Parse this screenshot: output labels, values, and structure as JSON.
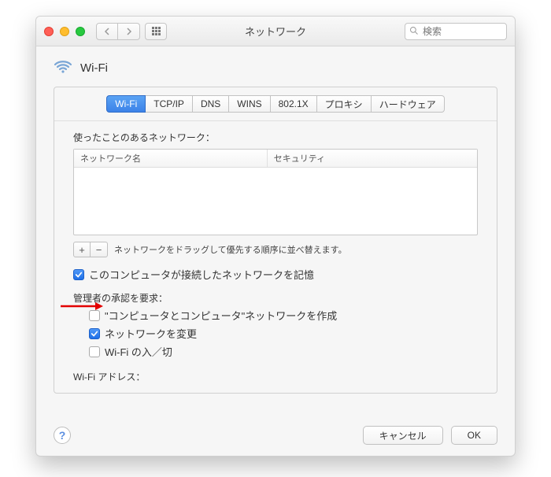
{
  "window": {
    "title": "ネットワーク",
    "search_placeholder": "検索"
  },
  "header": {
    "title": "Wi-Fi"
  },
  "tabs": [
    {
      "label": "Wi-Fi",
      "active": true
    },
    {
      "label": "TCP/IP",
      "active": false
    },
    {
      "label": "DNS",
      "active": false
    },
    {
      "label": "WINS",
      "active": false
    },
    {
      "label": "802.1X",
      "active": false
    },
    {
      "label": "プロキシ",
      "active": false
    },
    {
      "label": "ハードウェア",
      "active": false
    }
  ],
  "network_list": {
    "caption": "使ったことのあるネットワーク：",
    "col_name": "ネットワーク名",
    "col_security": "セキュリティ",
    "rows": []
  },
  "pm": {
    "plus": "+",
    "minus": "−",
    "hint": "ネットワークをドラッグして優先する順序に並べ替えます。"
  },
  "remember": {
    "checked": true,
    "label": "このコンピュータが接続したネットワークを記憶"
  },
  "admin_label": "管理者の承認を要求：",
  "admin": [
    {
      "checked": false,
      "label": "\"コンピュータとコンピュータ\"ネットワークを作成"
    },
    {
      "checked": true,
      "label": "ネットワークを変更"
    },
    {
      "checked": false,
      "label": "Wi-Fi の入／切"
    }
  ],
  "wifi_address_label": "Wi-Fi アドレス：",
  "footer": {
    "help": "?",
    "cancel": "キャンセル",
    "ok": "OK"
  }
}
